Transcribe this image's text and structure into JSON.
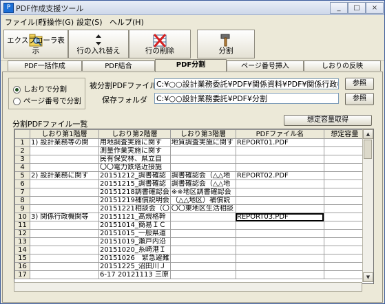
{
  "window": {
    "title": "PDF作成支援ツール"
  },
  "titlebar_buttons": [
    "_",
    "□",
    "×"
  ],
  "menu": [
    "ファイル(F)",
    "行操作(G)",
    "設定(S)",
    "ヘルプ(H)"
  ],
  "toolbar": {
    "explorer": "エクスプローラ表示",
    "swap_rows": "行の入れ替え",
    "delete_row": "行の削除",
    "split": "分割"
  },
  "tabs": [
    "PDF一括作成",
    "PDF結合",
    "PDF分割",
    "ページ番号挿入",
    "しおりの反映"
  ],
  "active_tab": "PDF分割",
  "split_mode": {
    "by_bookmark": "しおりで分割",
    "by_page": "ページ番号で分割",
    "selected": "しおりで分割"
  },
  "source_file": {
    "label": "被分割PDFファイル名",
    "value": "C:¥○○設計業務委託¥PDF¥関係資料¥PDF¥関係行政機関との協議"
  },
  "save_folder": {
    "label": "保存フォルダ",
    "value": "C:¥○○設計業務委託¥PDF¥分割"
  },
  "browse_label": "参照",
  "capacity_button": "想定容量取得",
  "list_title": "分割PDFファイル一覧",
  "grid": {
    "headers": [
      "",
      "しおり第1階層",
      "しおり第2階層",
      "しおり第3階層",
      "PDFファイル名",
      "想定容量"
    ],
    "rows": [
      [
        "1",
        "1) 設計業務等の関",
        "用地調査実施に関す",
        "地質調査実施に関す",
        "REPORT01.PDF",
        ""
      ],
      [
        "2",
        "",
        "測量作業実施に関す",
        "",
        "",
        ""
      ],
      [
        "3",
        "",
        "民有保安林、県立自",
        "",
        "",
        ""
      ],
      [
        "4",
        "",
        "〇〇電力鉄塔近接施",
        "",
        "",
        ""
      ],
      [
        "5",
        "2) 設計業務に関す",
        "20151212_調書確認",
        "調書確認会（△△地",
        "REPORT02.PDF",
        ""
      ],
      [
        "6",
        "",
        "20151215_調書確認",
        "調書確認会（△△地",
        "",
        ""
      ],
      [
        "7",
        "",
        "20151218調書確認会",
        "※※地区調書確認会",
        "",
        ""
      ],
      [
        "8",
        "",
        "20151219補償説明会",
        "（△△地区）補償説",
        "",
        ""
      ],
      [
        "9",
        "",
        "20151221相談会（〇",
        "〇〇東地区生活相談",
        "",
        ""
      ],
      [
        "10",
        "3) 関係行政機関等",
        "20151121_高規格幹",
        "",
        "REPORT03.PDF",
        ""
      ],
      [
        "11",
        "",
        "20151014_簡易ＩＣ",
        "",
        "",
        ""
      ],
      [
        "12",
        "",
        "20151015_一般県道",
        "",
        "",
        ""
      ],
      [
        "13",
        "",
        "20151019_瀬戸内沿",
        "",
        "",
        ""
      ],
      [
        "14",
        "",
        "20151020_糸崎港Ｉ",
        "",
        "",
        ""
      ],
      [
        "15",
        "",
        "20151026　緊急避難",
        "",
        "",
        ""
      ],
      [
        "16",
        "",
        "20151225_沼田川Ｊ",
        "",
        "",
        ""
      ],
      [
        "17",
        "",
        "6-17 20121113 三原",
        "",
        "",
        ""
      ]
    ],
    "selected_row": "10"
  },
  "icons": [
    "explorer-icon",
    "swap-rows-icon",
    "delete-row-icon",
    "split-hammer-icon"
  ],
  "colors": {
    "accent": "#1d6fd6",
    "delete_red": "#d62020",
    "panel_bg": "#ece9d8"
  }
}
